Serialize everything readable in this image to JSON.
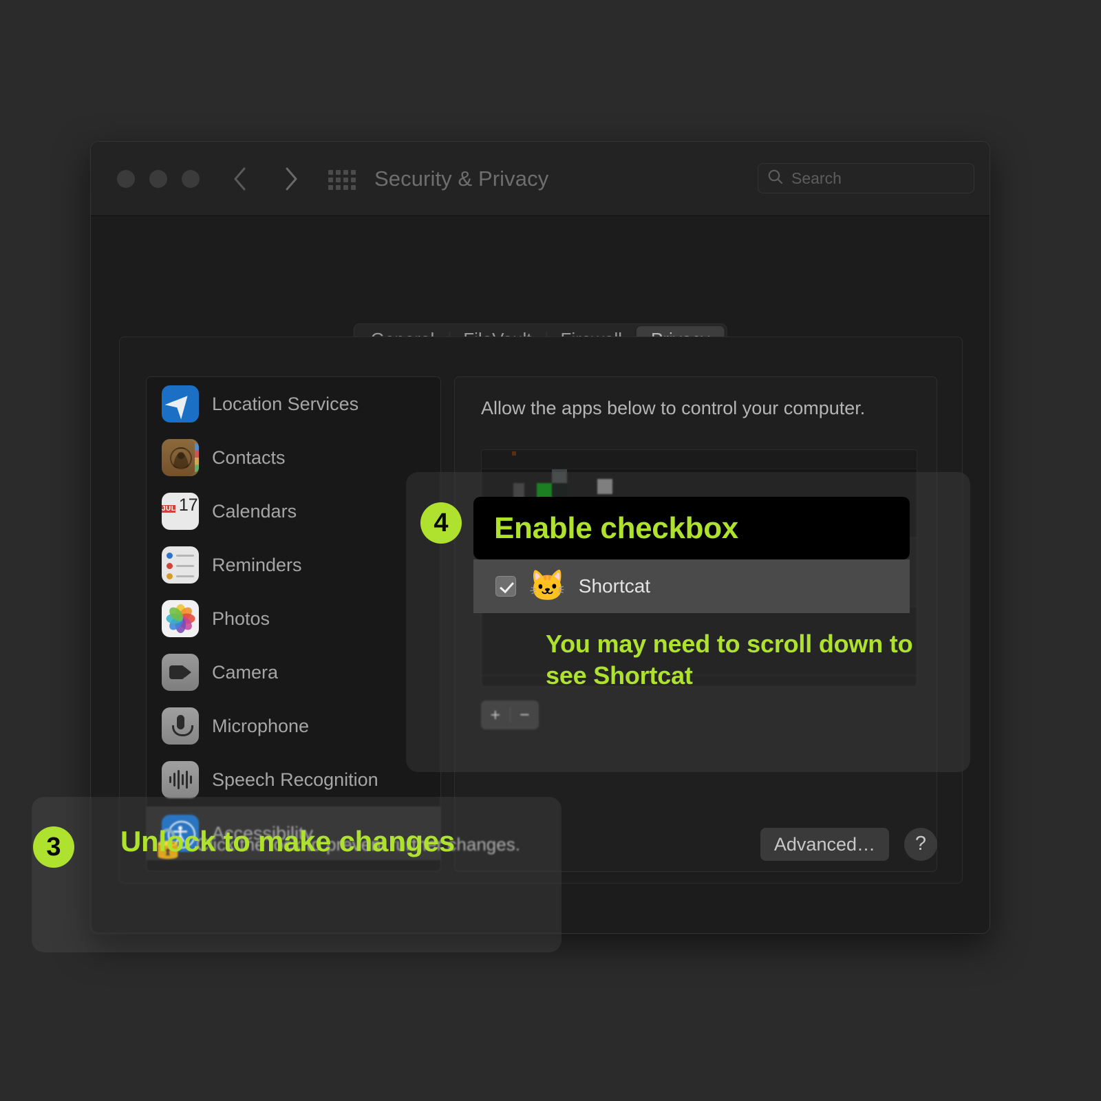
{
  "window": {
    "title": "Security & Privacy",
    "traffic_lights": [
      "close",
      "minimize",
      "zoom"
    ],
    "nav_back_icon": "chevron-left-icon",
    "nav_forward_icon": "chevron-right-icon",
    "grid_icon": "show-all-grid-icon",
    "search": {
      "placeholder": "Search",
      "value": "",
      "icon": "search-icon"
    }
  },
  "tabs": [
    {
      "label": "General",
      "selected": false
    },
    {
      "label": "FileVault",
      "selected": false
    },
    {
      "label": "Firewall",
      "selected": false
    },
    {
      "label": "Privacy",
      "selected": true
    }
  ],
  "sidebar": {
    "items": [
      {
        "label": "Location Services",
        "icon": "location-services-icon",
        "selected": false
      },
      {
        "label": "Contacts",
        "icon": "contacts-icon",
        "selected": false
      },
      {
        "label": "Calendars",
        "icon": "calendar-icon",
        "selected": false
      },
      {
        "label": "Reminders",
        "icon": "reminders-icon",
        "selected": false
      },
      {
        "label": "Photos",
        "icon": "photos-icon",
        "selected": false
      },
      {
        "label": "Camera",
        "icon": "camera-icon",
        "selected": false
      },
      {
        "label": "Microphone",
        "icon": "microphone-icon",
        "selected": false
      },
      {
        "label": "Speech Recognition",
        "icon": "speech-recognition-icon",
        "selected": false
      },
      {
        "label": "Accessibility",
        "icon": "accessibility-icon",
        "selected": true
      }
    ],
    "calendar_icon": {
      "month": "JUL",
      "day": "17"
    }
  },
  "detail": {
    "heading": "Allow the apps below to control your computer.",
    "rows": [
      {
        "name": "",
        "redacted": true,
        "checked": false
      },
      {
        "name": "",
        "redacted": true,
        "checked": false
      },
      {
        "name": "Shortcat",
        "redacted": false,
        "checked": true,
        "icon": "cat-emoji"
      }
    ],
    "add_button": "+",
    "remove_button": "−"
  },
  "footer": {
    "lock_icon": "unlocked-padlock-icon",
    "lock_text": "Click the lock to prevent further changes.",
    "advanced_label": "Advanced…",
    "help_label": "?"
  },
  "callouts": [
    {
      "number": "3",
      "title": "Unlock to make changes",
      "accent": "#aee22e"
    },
    {
      "number": "4",
      "title": "Enable checkbox",
      "note": "You may need to scroll down to see Shortcat",
      "accent": "#aee22e"
    }
  ],
  "colors": {
    "accent_green": "#aee22e",
    "page_background": "#2b2b2b",
    "window_background": "#1c1c1c",
    "selected_row": "#2c2c2c"
  }
}
